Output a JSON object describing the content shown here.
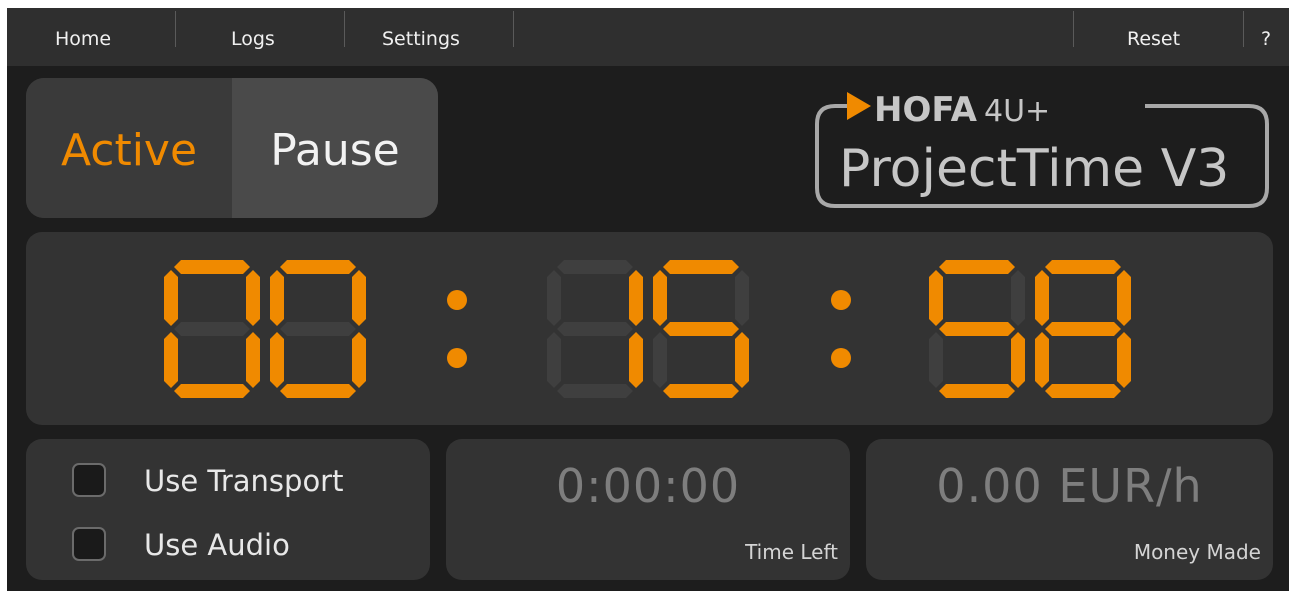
{
  "menu": {
    "home": "Home",
    "logs": "Logs",
    "settings": "Settings",
    "reset": "Reset",
    "help": "?"
  },
  "status": {
    "active_label": "Active",
    "pause_label": "Pause",
    "selected": "Active"
  },
  "logo": {
    "brand": "HOFA",
    "brand_suffix": "4U+",
    "product": "ProjectTime V3"
  },
  "timer": {
    "hours": "00",
    "minutes": "15",
    "seconds": "58",
    "separator": ":"
  },
  "options": {
    "use_transport": {
      "label": "Use Transport",
      "checked": false
    },
    "use_audio": {
      "label": "Use Audio",
      "checked": false
    }
  },
  "time_left": {
    "value": "0:00:00",
    "caption": "Time Left"
  },
  "money_made": {
    "value": "0.00 EUR/h",
    "caption": "Money Made"
  },
  "colors": {
    "accent": "#f08a00",
    "segment_on": "#f08a00",
    "segment_off": "#3f3f3f",
    "panel": "#333333",
    "background": "#1d1d1d"
  },
  "icons": {
    "brand_triangle": "play-triangle-icon"
  }
}
